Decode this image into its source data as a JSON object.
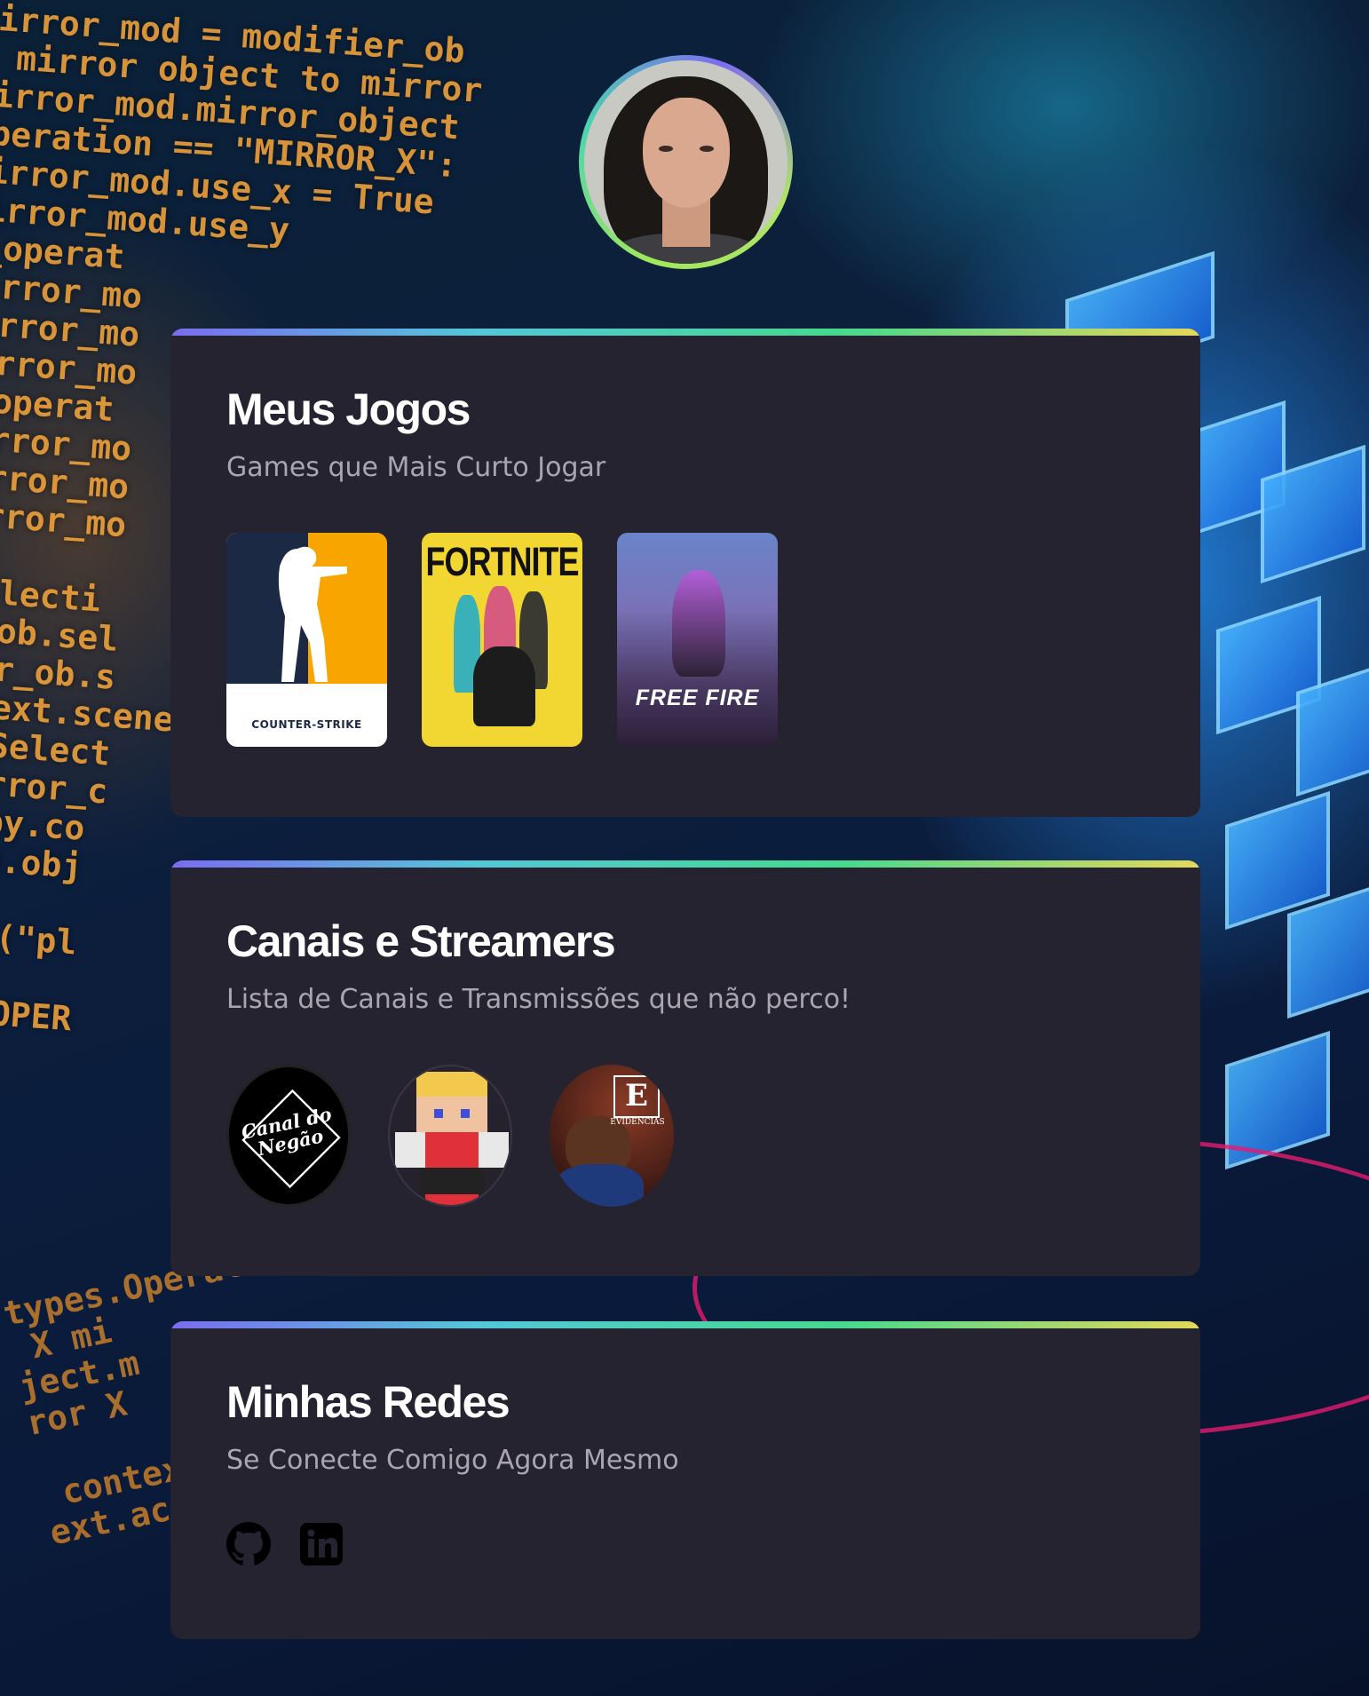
{
  "profile": {
    "avatar_alt": "Foto de perfil"
  },
  "games_section": {
    "title": "Meus Jogos",
    "subtitle": "Games que Mais Curto Jogar",
    "games": [
      {
        "name": "Counter Strike",
        "caption": "COUNTER-STRIKE"
      },
      {
        "name": "Fortnite",
        "caption": "FORTNITE"
      },
      {
        "name": "Free Fire",
        "caption": "FREE FIRE"
      }
    ]
  },
  "channels_section": {
    "title": "Canais e Streamers",
    "subtitle": "Lista de Canais e Transmissões que não perco!",
    "channels": [
      {
        "name": "Canal do Negão",
        "caption": "Canal do Negão"
      },
      {
        "name": "Pixel streamer"
      },
      {
        "name": "Evidências",
        "caption": "EVIDÊNCIAS"
      }
    ]
  },
  "social_section": {
    "title": "Minhas Redes",
    "subtitle": "Se Conecte Comigo Agora Mesmo",
    "links": [
      {
        "name": "GitHub",
        "icon": "github-icon"
      },
      {
        "name": "LinkedIn",
        "icon": "linkedin-icon"
      }
    ]
  },
  "colors": {
    "card_bg": "#262330",
    "title": "#ffffff",
    "subtitle": "#a9a6b1",
    "accent_gradient": [
      "#7b6cf0",
      "#54c7d8",
      "#46d98e",
      "#e5d85a"
    ]
  }
}
